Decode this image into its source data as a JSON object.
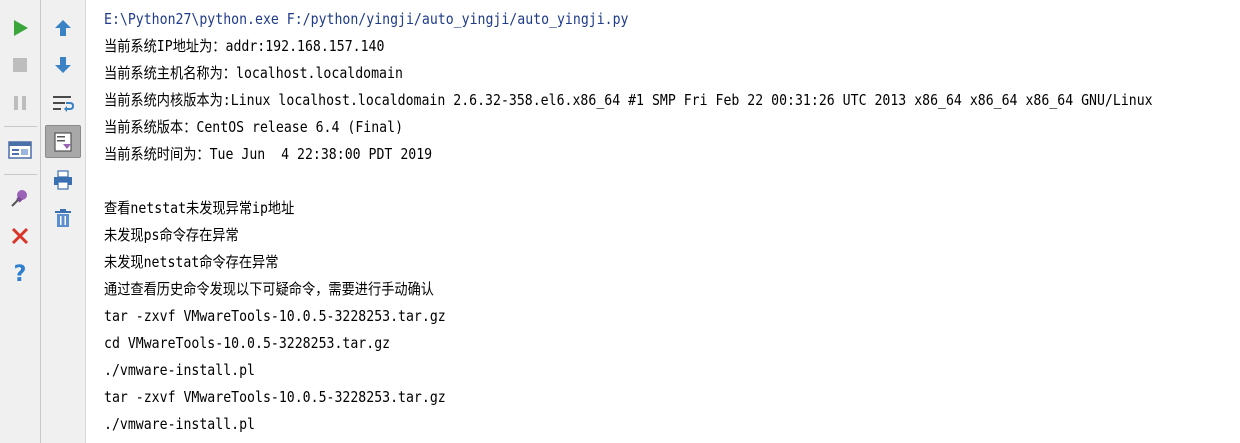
{
  "console": {
    "lines": [
      {
        "text": "E:\\Python27\\python.exe F:/python/yingji/auto_yingji/auto_yingji.py",
        "kind": "cmd"
      },
      {
        "text": "当前系统IP地址为：addr:192.168.157.140",
        "kind": "out"
      },
      {
        "text": "当前系统主机名称为：localhost.localdomain",
        "kind": "out"
      },
      {
        "text": "当前系统内核版本为:Linux localhost.localdomain 2.6.32-358.el6.x86_64 #1 SMP Fri Feb 22 00:31:26 UTC 2013 x86_64 x86_64 x86_64 GNU/Linux",
        "kind": "out"
      },
      {
        "text": "当前系统版本：CentOS release 6.4 (Final)",
        "kind": "out"
      },
      {
        "text": "当前系统时间为：Tue Jun  4 22:38:00 PDT 2019",
        "kind": "out"
      },
      {
        "text": "",
        "kind": "out"
      },
      {
        "text": "查看netstat未发现异常ip地址",
        "kind": "out"
      },
      {
        "text": "未发现ps命令存在异常",
        "kind": "out"
      },
      {
        "text": "未发现netstat命令存在异常",
        "kind": "out"
      },
      {
        "text": "通过查看历史命令发现以下可疑命令，需要进行手动确认",
        "kind": "out"
      },
      {
        "text": "tar -zxvf VMwareTools-10.0.5-3228253.tar.gz",
        "kind": "out"
      },
      {
        "text": "cd VMwareTools-10.0.5-3228253.tar.gz",
        "kind": "out"
      },
      {
        "text": "./vmware-install.pl",
        "kind": "out"
      },
      {
        "text": "tar -zxvf VMwareTools-10.0.5-3228253.tar.gz",
        "kind": "out"
      },
      {
        "text": "./vmware-install.pl",
        "kind": "out"
      }
    ]
  },
  "toolbar": {
    "left": [
      {
        "name": "run-icon",
        "interactable": true
      },
      {
        "name": "stop-icon",
        "interactable": true
      },
      {
        "name": "pause-icon",
        "interactable": true
      },
      {
        "name": "layout-icon",
        "interactable": true
      },
      {
        "name": "pin-icon",
        "interactable": true
      },
      {
        "name": "close-icon",
        "interactable": true
      },
      {
        "name": "help-icon",
        "interactable": true
      }
    ],
    "right": [
      {
        "name": "arrow-up-icon",
        "interactable": true
      },
      {
        "name": "arrow-down-icon",
        "interactable": true
      },
      {
        "name": "soft-wrap-icon",
        "interactable": true
      },
      {
        "name": "scroll-to-end-icon",
        "interactable": true,
        "active": true
      },
      {
        "name": "print-icon",
        "interactable": true
      },
      {
        "name": "trash-icon",
        "interactable": true
      }
    ]
  },
  "colors": {
    "run": "#3aa53a",
    "arrow": "#3a82c4",
    "close": "#d9352b",
    "help": "#2f7fd0",
    "command_text": "#1f3c88"
  }
}
